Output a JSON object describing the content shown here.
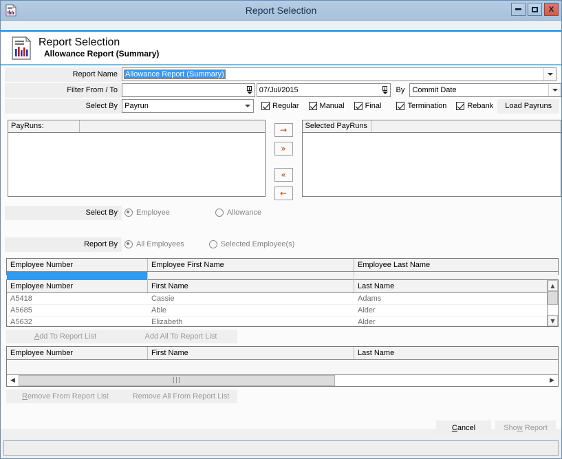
{
  "window": {
    "title": "Report Selection",
    "icon": "report-chart-icon",
    "minimize_label": "Minimize",
    "maximize_label": "Maximize",
    "close_label": "X"
  },
  "header": {
    "title": "Report Selection",
    "subtitle": "Allowance Report (Summary)"
  },
  "form": {
    "report_name_label": "Report Name",
    "report_name_value": "Allowance Report (Summary)",
    "filter_label": "Filter From / To",
    "filter_from_value": "",
    "filter_to_value": "07/Jul/2015",
    "by_label": "By",
    "by_value": "Commit Date",
    "select_by_label": "Select By",
    "select_by_value": "Payrun",
    "checkboxes": [
      {
        "label": "Regular",
        "checked": true
      },
      {
        "label": "Manual",
        "checked": true
      },
      {
        "label": "Final",
        "checked": true
      },
      {
        "label": "Termination",
        "checked": true
      },
      {
        "label": "Rebank",
        "checked": true
      }
    ],
    "load_payruns_label": "Load Payruns"
  },
  "payruns": {
    "available_header": "PayRuns:",
    "selected_header": "Selected PayRuns",
    "available_items": [],
    "selected_items": [],
    "transfer_buttons": [
      {
        "name": "move-right-button",
        "glyph": "→"
      },
      {
        "name": "move-all-right-button",
        "glyph": "»"
      },
      {
        "name": "move-all-left-button",
        "glyph": "«"
      },
      {
        "name": "move-left-button",
        "glyph": "←"
      }
    ]
  },
  "select_by_group": {
    "label": "Select By",
    "options": [
      {
        "label": "Employee",
        "selected": true
      },
      {
        "label": "Allowance",
        "selected": false
      }
    ]
  },
  "report_by_group": {
    "label": "Report By",
    "options": [
      {
        "label": "All Employees",
        "selected": true
      },
      {
        "label": "Selected Employee(s)",
        "selected": false
      }
    ]
  },
  "filter_grid": {
    "columns": [
      "Employee Number",
      "Employee First Name",
      "Employee Last Name"
    ],
    "filter_values": [
      "",
      "",
      ""
    ]
  },
  "employee_grid": {
    "columns": [
      "Employee Number",
      "First Name",
      "Last Name"
    ],
    "rows": [
      {
        "number": "A5418",
        "first": "Cassie",
        "last": "Adams"
      },
      {
        "number": "A5685",
        "first": "Able",
        "last": "Alder"
      },
      {
        "number": "A5632",
        "first": "Elizabeth",
        "last": "Alder"
      }
    ]
  },
  "add_buttons": {
    "add_label": "Add To Report List",
    "add_accel": "A",
    "add_all_label": "Add All To Report List"
  },
  "report_grid": {
    "columns": [
      "Employee Number",
      "First Name",
      "Last Name"
    ],
    "rows": []
  },
  "remove_buttons": {
    "remove_label": "Remove From Report List",
    "remove_accel": "R",
    "remove_all_label": "Remove All From Report List"
  },
  "footer": {
    "cancel_label": "Cancel",
    "cancel_accel": "C",
    "show_report_label": "Show Report",
    "show_report_accel": "w"
  }
}
